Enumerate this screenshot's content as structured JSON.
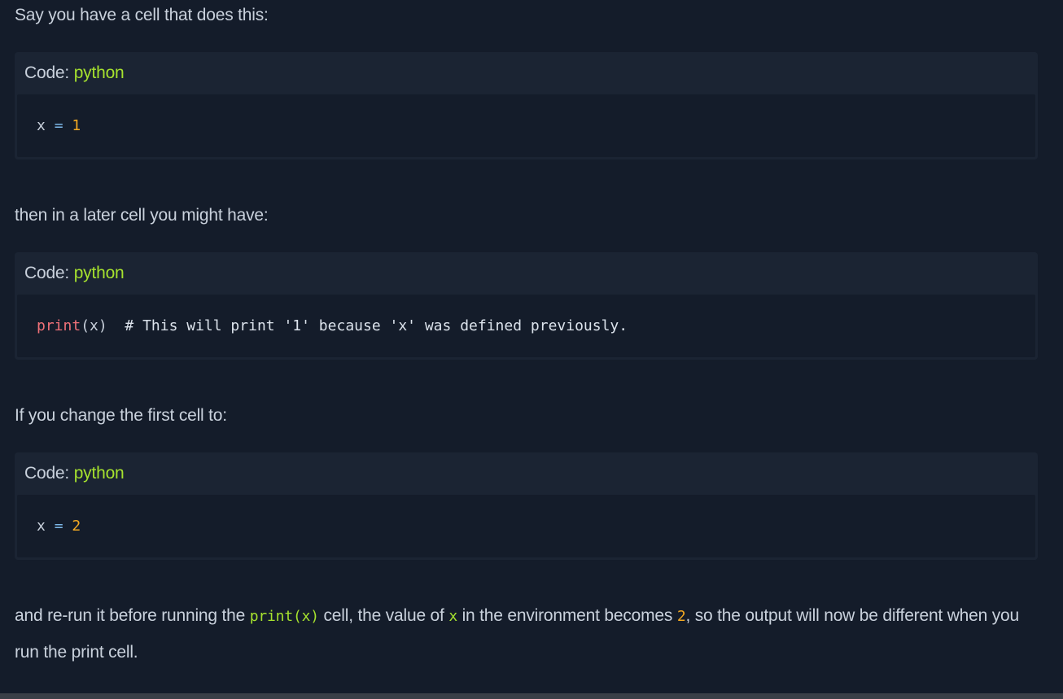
{
  "blocks": [
    {
      "type": "text",
      "text": "Say you have a cell that does this:"
    },
    {
      "type": "code",
      "header_label": "Code: ",
      "language": "python",
      "code": "x = 1"
    },
    {
      "type": "text",
      "text": "then in a later cell you might have:"
    },
    {
      "type": "code",
      "header_label": "Code: ",
      "language": "python",
      "code": "print(x)  # This will print '1' because 'x' was defined previously."
    },
    {
      "type": "text",
      "text": "If you change the first cell to:"
    },
    {
      "type": "code",
      "header_label": "Code: ",
      "language": "python",
      "code": "x = 2"
    }
  ],
  "final_paragraph": {
    "part1": "and re-run it before running the ",
    "code1": "print(x)",
    "part2": " cell, the value of ",
    "code2": "x",
    "part3": " in the environment becomes ",
    "code3": "2",
    "part4": ", so the output will now be different when you run the print cell."
  },
  "tokens": {
    "block1": {
      "var": "x",
      "op": "=",
      "num": "1"
    },
    "block2": {
      "fn": "print",
      "args": "(x)",
      "comment": "# This will print '1' because 'x' was defined previously."
    },
    "block3": {
      "var": "x",
      "op": "=",
      "num": "2"
    }
  },
  "colors": {
    "background": "#141c2a",
    "code_header_bg": "#1b2433",
    "text": "#c9d1dc",
    "language_accent": "#a6e22e",
    "number": "#f4a922",
    "function": "#f07178",
    "operator": "#7cb8e8"
  }
}
